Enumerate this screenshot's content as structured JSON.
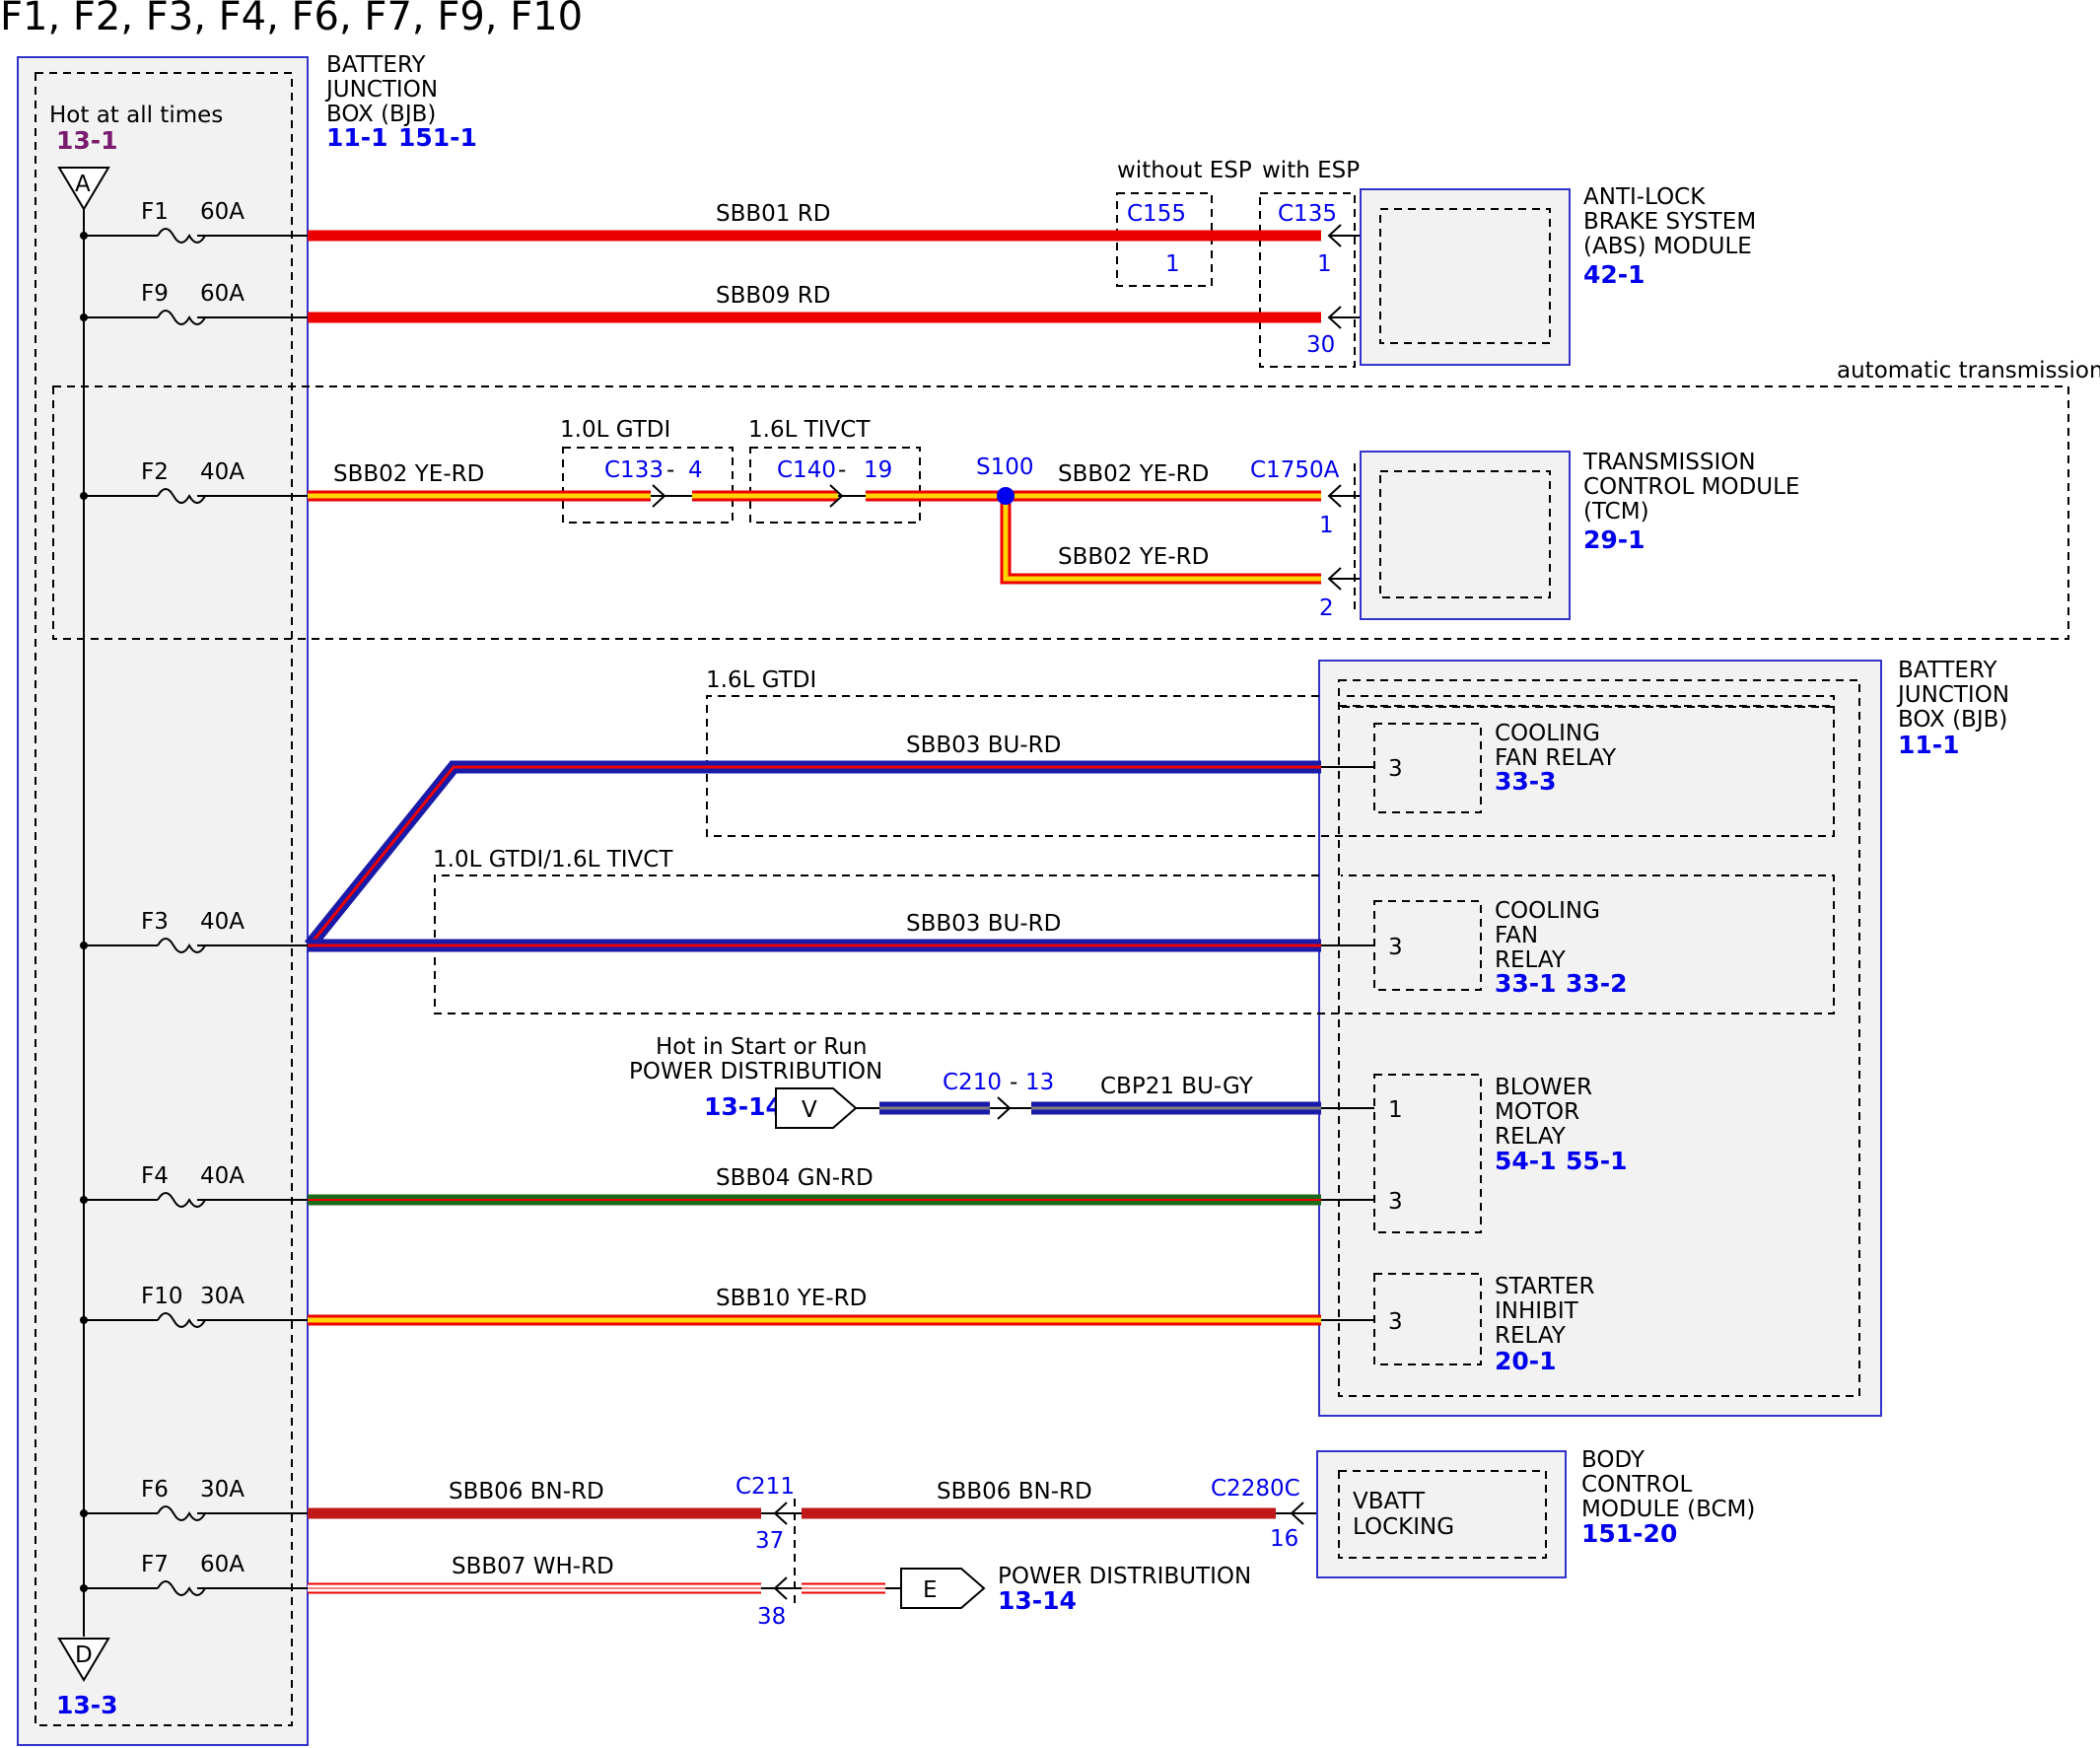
{
  "title": "F1, F2, F3, F4, F6, F7, F9, F10",
  "colors": {
    "RD": "#ee0000",
    "YE": "#ffd400",
    "BU": "#1a1aaa",
    "GN": "#1a6b1a",
    "BN": "#c01818",
    "WH": "#ffffff",
    "GY": "#7f7f7f",
    "component_fill": "#f2f2f2",
    "component_border": "#3333cc",
    "ref_blue": "#0000ee",
    "ref_purple": "#7a1c6e"
  },
  "bjb_left": {
    "name_lines": [
      "BATTERY",
      "JUNCTION",
      "BOX (BJB)"
    ],
    "refs": [
      "11-1",
      "151-1"
    ],
    "hot_label": "Hot at all times",
    "hot_ref": "13-1",
    "top_connector": "A",
    "bottom_connector": "D",
    "bottom_ref": "13-3"
  },
  "fuses": [
    {
      "id": "F1",
      "rating": "60A"
    },
    {
      "id": "F9",
      "rating": "60A"
    },
    {
      "id": "F2",
      "rating": "40A"
    },
    {
      "id": "F3",
      "rating": "40A"
    },
    {
      "id": "F4",
      "rating": "40A"
    },
    {
      "id": "F10",
      "rating": "30A"
    },
    {
      "id": "F6",
      "rating": "30A"
    },
    {
      "id": "F7",
      "rating": "60A"
    }
  ],
  "circuits": {
    "sbb01": "SBB01  RD",
    "sbb09": "SBB09  RD",
    "sbb02_a": "SBB02  YE-RD",
    "sbb02_b": "SBB02  YE-RD",
    "sbb02_c": "SBB02  YE-RD",
    "sbb03_a": "SBB03  BU-RD",
    "sbb03_b": "SBB03  BU-RD",
    "cbp21": "CBP21  BU-GY",
    "sbb04": "SBB04  GN-RD",
    "sbb10": "SBB10  YE-RD",
    "sbb06_a": "SBB06  BN-RD",
    "sbb06_b": "SBB06  BN-RD",
    "sbb07": "SBB07  WH-RD"
  },
  "abs": {
    "options": [
      "without ESP",
      "with ESP"
    ],
    "c155": "C155",
    "c155_pin": "1",
    "c135": "C135",
    "c135_pins": [
      "1",
      "30"
    ],
    "name_lines": [
      "ANTI-LOCK",
      "BRAKE SYSTEM",
      "(ABS) MODULE"
    ],
    "ref": "42-1"
  },
  "tcm": {
    "region_label": "automatic transmission",
    "opt1": "1.0L GTDI",
    "opt2": "1.6L TIVCT",
    "c133": "C133",
    "c133_pin": "4",
    "c140": "C140",
    "c140_pin": "19",
    "splice": "S100",
    "c1750": "C1750A",
    "pins": [
      "1",
      "2"
    ],
    "name_lines": [
      "TRANSMISSION",
      "CONTROL MODULE",
      "(TCM)"
    ],
    "ref": "29-1"
  },
  "bjb_right": {
    "name_lines": [
      "BATTERY",
      "JUNCTION",
      "BOX (BJB)"
    ],
    "ref": "11-1",
    "opt_gtdi": "1.6L GTDI",
    "opt_tivct": "1.0L GTDI/1.6L TIVCT",
    "cooling_fan_relay": {
      "name_lines": [
        "COOLING",
        "FAN RELAY"
      ],
      "ref": "33-3",
      "pin": "3"
    },
    "cooling_fan_relay2": {
      "name_lines": [
        "COOLING",
        "FAN",
        "RELAY"
      ],
      "refs": [
        "33-1",
        "33-2"
      ],
      "pin": "3"
    },
    "blower_relay": {
      "name_lines": [
        "BLOWER",
        "MOTOR",
        "RELAY"
      ],
      "refs": [
        "54-1",
        "55-1"
      ],
      "pins": [
        "1",
        "3"
      ]
    },
    "starter_relay": {
      "name_lines": [
        "STARTER",
        "INHIBIT",
        "RELAY"
      ],
      "ref": "20-1",
      "pin": "3"
    }
  },
  "power_v": {
    "label_lines": [
      "Hot in Start or Run",
      "POWER DISTRIBUTION"
    ],
    "ref": "13-14",
    "connector": "V",
    "c210": "C210",
    "c210_pin": "13"
  },
  "bcm": {
    "c211": "C211",
    "c211_pins": [
      "37",
      "38"
    ],
    "c2280": "C2280C",
    "pin": "16",
    "inner_lines": [
      "VBATT",
      "LOCKING"
    ],
    "name_lines": [
      "BODY",
      "CONTROL",
      "MODULE (BCM)"
    ],
    "ref": "151-20"
  },
  "power_e": {
    "connector": "E",
    "label": "POWER DISTRIBUTION",
    "ref": "13-14"
  }
}
